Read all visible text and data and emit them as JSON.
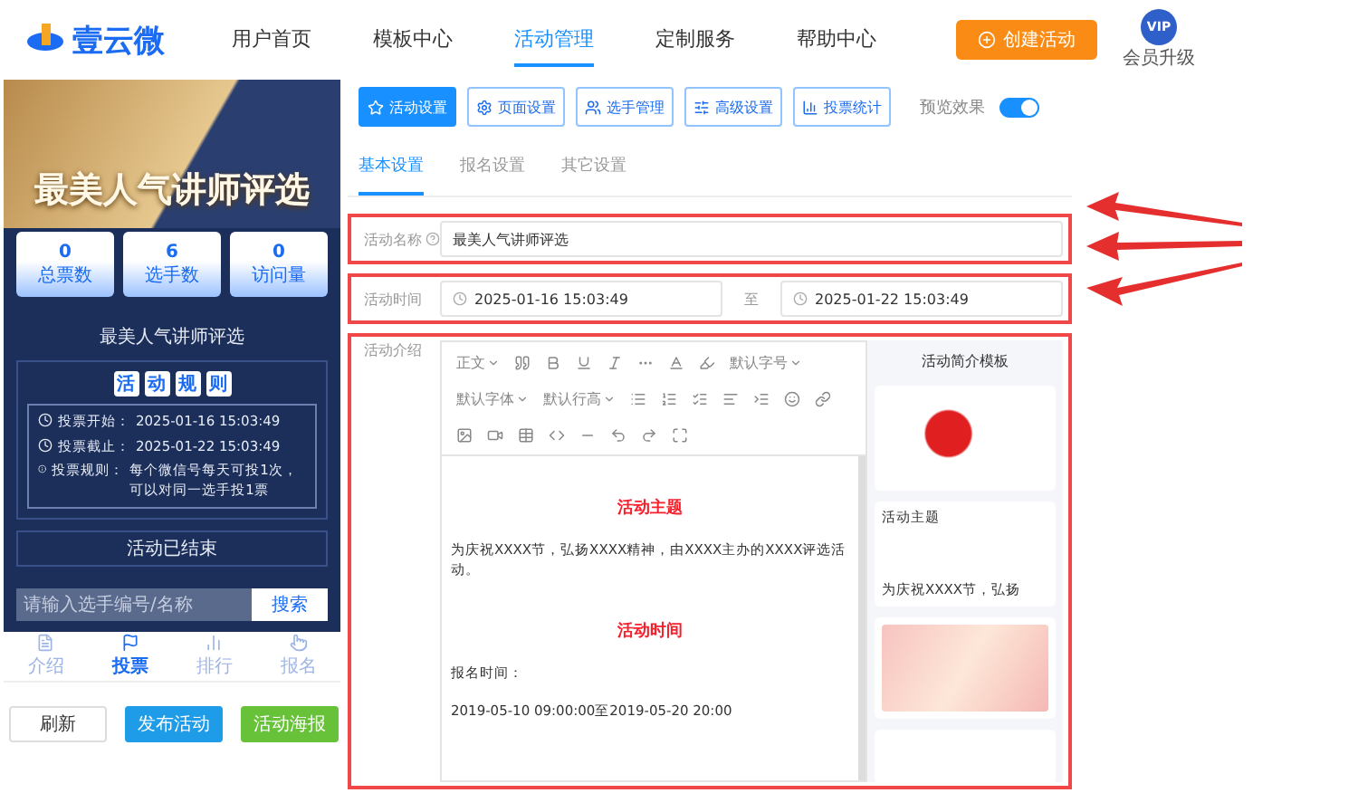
{
  "header": {
    "logo": "壹云微",
    "nav": [
      {
        "label": "用户首页",
        "selected": false
      },
      {
        "label": "模板中心",
        "selected": false
      },
      {
        "label": "活动管理",
        "selected": true
      },
      {
        "label": "定制服务",
        "selected": false
      },
      {
        "label": "帮助中心",
        "selected": false
      }
    ],
    "create_button": "创建活动",
    "vip_badge": "VIP",
    "vip_label": "会员升级"
  },
  "preview": {
    "banner_title": "最美人气讲师评选",
    "stats": [
      {
        "value": "0",
        "label": "总票数"
      },
      {
        "value": "6",
        "label": "选手数"
      },
      {
        "value": "0",
        "label": "访问量"
      }
    ],
    "subtitle": "最美人气讲师评选",
    "rules_heading": [
      "活",
      "动",
      "规",
      "则"
    ],
    "rules": [
      {
        "label": "投票开始：",
        "value": "2025-01-16 15:03:49"
      },
      {
        "label": "投票截止：",
        "value": "2025-01-22 15:03:49"
      },
      {
        "label": "投票规则：",
        "value": "每个微信号每天可投1次，可以对同一选手投1票"
      }
    ],
    "status": "活动已结束",
    "search": {
      "placeholder": "请输入选手编号/名称",
      "button": "搜索"
    },
    "tabbar": [
      {
        "label": "介绍",
        "selected": false
      },
      {
        "label": "投票",
        "selected": true
      },
      {
        "label": "排行",
        "selected": false
      },
      {
        "label": "报名",
        "selected": false
      }
    ],
    "actions": [
      {
        "label": "刷新",
        "kind": "plain"
      },
      {
        "label": "发布活动",
        "kind": "primary"
      },
      {
        "label": "活动海报",
        "kind": "success"
      }
    ]
  },
  "toolbar": {
    "buttons": [
      {
        "label": "活动设置",
        "selected": true
      },
      {
        "label": "页面设置",
        "selected": false
      },
      {
        "label": "选手管理",
        "selected": false
      },
      {
        "label": "高级设置",
        "selected": false
      },
      {
        "label": "投票统计",
        "selected": false
      }
    ],
    "preview_label": "预览效果",
    "preview_on": true
  },
  "tabs": [
    {
      "label": "基本设置",
      "selected": true
    },
    {
      "label": "报名设置",
      "selected": false
    },
    {
      "label": "其它设置",
      "selected": false
    }
  ],
  "form": {
    "name_label": "活动名称",
    "name_value": "最美人气讲师评选",
    "time_label": "活动时间",
    "start": "2025-01-16 15:03:49",
    "separator": "至",
    "end": "2025-01-22 15:03:49",
    "intro_label": "活动介绍"
  },
  "editor": {
    "dropdowns": [
      "正文",
      "默认字号",
      "默认字体",
      "默认行高"
    ],
    "content": [
      {
        "kind": "heading",
        "text": "活动主题"
      },
      {
        "kind": "paragraph",
        "text": "为庆祝XXXX节，弘扬XXXX精神，由XXXX主办的XXXX评选活动。"
      },
      {
        "kind": "heading",
        "text": "活动时间"
      },
      {
        "kind": "paragraph",
        "text": "报名时间："
      },
      {
        "kind": "paragraph",
        "text": "2019-05-10 09:00:00至2019-05-20 20:00"
      }
    ]
  },
  "templates": {
    "title": "活动简介模板",
    "cards": [
      {
        "kind": "festive"
      },
      {
        "kind": "text",
        "title": "活动主题",
        "body": "为庆祝XXXX节，弘扬"
      },
      {
        "kind": "pink"
      },
      {
        "kind": "blank"
      }
    ]
  }
}
